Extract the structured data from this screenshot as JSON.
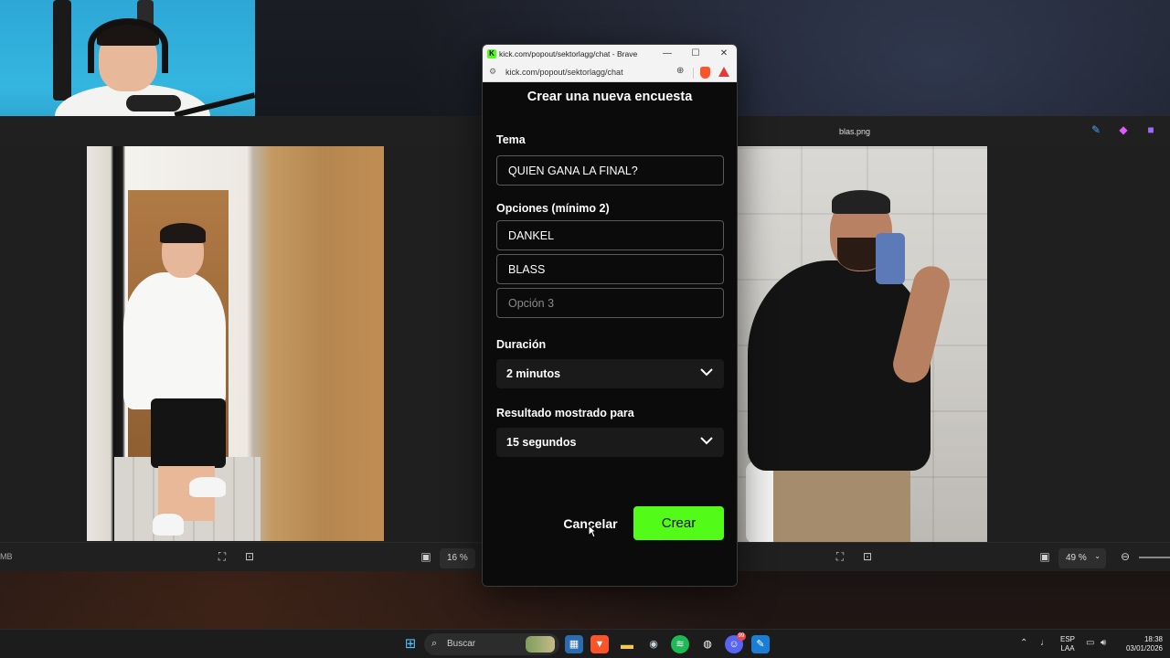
{
  "webcam": {
    "label": "streamer-webcam"
  },
  "viewer_left": {
    "size_label": "MB",
    "zoom": "16 %"
  },
  "viewer_right": {
    "file_name": "blas.png",
    "zoom": "49 %"
  },
  "browser": {
    "window_title": "kick.com/popout/sektorlagg/chat - Brave",
    "url": "kick.com/popout/sektorlagg/chat",
    "minimize": "—",
    "maximize": "☐",
    "close": "✕"
  },
  "poll": {
    "heading": "Crear una nueva encuesta",
    "topic_label": "Tema",
    "topic_value": "QUIEN GANA LA FINAL?",
    "options_label": "Opciones (mínimo 2)",
    "options": [
      {
        "value": "DANKEL",
        "placeholder": ""
      },
      {
        "value": "BLASS",
        "placeholder": ""
      },
      {
        "value": "",
        "placeholder": "Opción 3"
      }
    ],
    "duration_label": "Duración",
    "duration_value": "2 minutos",
    "result_label": "Resultado mostrado para",
    "result_value": "15 segundos",
    "cancel_label": "Cancelar",
    "create_label": "Crear"
  },
  "taskbar": {
    "search_placeholder": "Buscar",
    "lang_top": "ESP",
    "lang_bottom": "LAA",
    "time": "18:38",
    "date": "03/01/2026",
    "discord_badge": "99"
  },
  "colors": {
    "kick_green": "#53fc18",
    "popup_bg": "#0b0b0c",
    "input_border": "#5a5a5a",
    "taskbar_bg": "#1c1c1c"
  }
}
